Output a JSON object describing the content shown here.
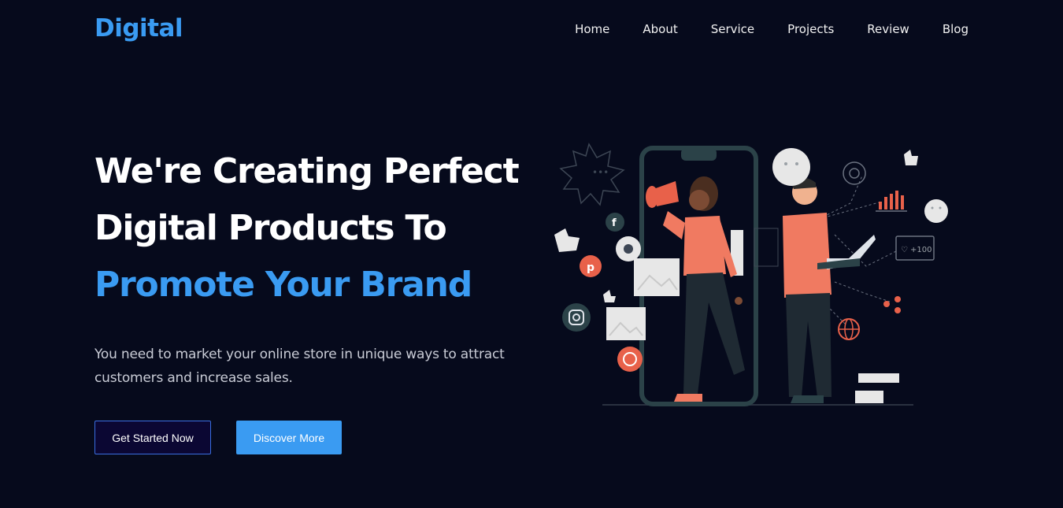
{
  "brand": {
    "logo": "Digital",
    "accent_color": "#3a9bf2",
    "background_color": "#060a1c"
  },
  "nav": {
    "items": [
      {
        "label": "Home"
      },
      {
        "label": "About"
      },
      {
        "label": "Service"
      },
      {
        "label": "Projects"
      },
      {
        "label": "Review"
      },
      {
        "label": "Blog"
      }
    ]
  },
  "hero": {
    "title_line1": "We're Creating Perfect",
    "title_line2": "Digital Products To",
    "title_line3": "Promote Your Brand",
    "subtitle_line1": "You need to market your online store in unique ways to attract",
    "subtitle_line2": "customers and increase sales.",
    "primary_button": "Get Started Now",
    "secondary_button": "Discover More"
  },
  "illustration": {
    "description": "marketing illustration",
    "social_icons": [
      "facebook-icon",
      "pinterest-icon",
      "instagram-icon",
      "whatsapp-icon",
      "chrome-icon",
      "globe-icon",
      "share-icon",
      "thumbs-up-icon"
    ],
    "like_badge": "+100"
  }
}
